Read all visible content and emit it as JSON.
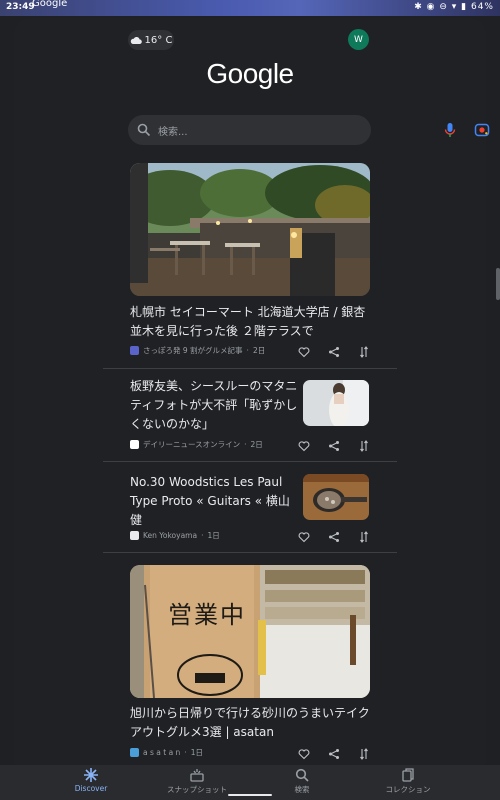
{
  "status_bar": {
    "time": "23:49",
    "app_name": "Google",
    "battery": "64%"
  },
  "header": {
    "weather_temp": "16° C",
    "avatar_initial": "W",
    "logo": "Google"
  },
  "search": {
    "placeholder": "検索..."
  },
  "cards": [
    {
      "title": "札幌市 セイコーマート 北海道大学店 / 銀杏並木を見に行った後 ２階テラスで",
      "source": "さっぽろ発 9 割がグルメ記事",
      "age": "2日"
    },
    {
      "title": "板野友美、シースルーのマタニティフォトが大不評「恥ずかしくないのかな」",
      "source": "デイリーニュースオンライン",
      "age": "2日"
    },
    {
      "title": "No.30 Woodstics Les Paul Type Proto « Guitars « 横山 健",
      "source": "Ken Yokoyama",
      "age": "1日"
    },
    {
      "title": "旭川から日帰りで行ける砂川のうまいテイクアウトグルメ3選 | asatan",
      "source": "a s a t a n",
      "age": "1日"
    }
  ],
  "bottom_nav": [
    {
      "label": "Discover",
      "icon": "discover-icon",
      "active": true
    },
    {
      "label": "スナップショット",
      "icon": "snapshot-icon",
      "active": false
    },
    {
      "label": "検索",
      "icon": "search-icon",
      "active": false
    },
    {
      "label": "コレクション",
      "icon": "collections-icon",
      "active": false
    }
  ],
  "colors": {
    "background": "#202124",
    "active_nav": "#8ab4f8",
    "avatar": "#0f7a5a"
  }
}
